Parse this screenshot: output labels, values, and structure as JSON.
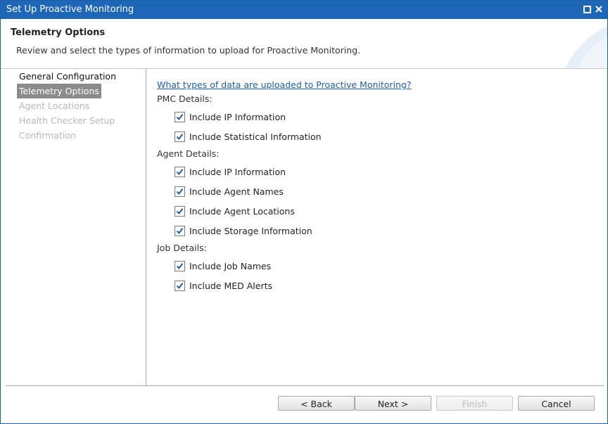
{
  "window": {
    "title": "Set Up Proactive Monitoring"
  },
  "header": {
    "title": "Telemetry Options",
    "subtitle": "Review and select the types of information to upload for Proactive Monitoring."
  },
  "nav": {
    "items": [
      {
        "label": "General Configuration",
        "state": "done"
      },
      {
        "label": "Telemetry Options",
        "state": "active"
      },
      {
        "label": "Agent Locations",
        "state": "disabled"
      },
      {
        "label": "Health Checker Setup",
        "state": "disabled"
      },
      {
        "label": "Confirmation",
        "state": "disabled"
      }
    ]
  },
  "content": {
    "info_link": "What types of data are uploaded to Proactive Monitoring?",
    "pmc": {
      "heading": "PMC Details:",
      "options": [
        {
          "label": "Include IP Information",
          "checked": true
        },
        {
          "label": "Include Statistical Information",
          "checked": true
        }
      ]
    },
    "agent": {
      "heading": "Agent Details:",
      "options": [
        {
          "label": "Include IP Information",
          "checked": true
        },
        {
          "label": "Include Agent Names",
          "checked": true
        },
        {
          "label": "Include Agent Locations",
          "checked": true
        },
        {
          "label": "Include Storage Information",
          "checked": true
        }
      ]
    },
    "job": {
      "heading": "Job Details:",
      "options": [
        {
          "label": "Include Job Names",
          "checked": true
        },
        {
          "label": "Include MED Alerts",
          "checked": true
        }
      ]
    }
  },
  "footer": {
    "back_label": "< Back",
    "next_label": "Next >",
    "finish_label": "Finish",
    "cancel_label": "Cancel"
  },
  "colors": {
    "titlebar": "#1d66b8",
    "link": "#1a5fb0",
    "check": "#1d5fa8",
    "nav_active": "#8b8b8b"
  }
}
